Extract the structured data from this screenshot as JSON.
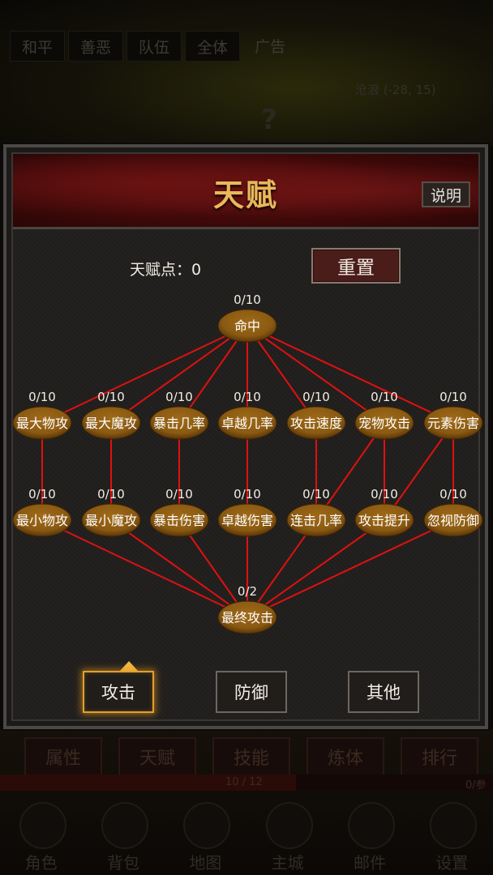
{
  "background": {
    "top_tabs": [
      "和平",
      "善恶",
      "队伍",
      "全体",
      "广告"
    ],
    "coords": "沧浪 (-28, 15)",
    "question_mark": "?",
    "menu_buttons": [
      "属性",
      "天赋",
      "技能",
      "炼体",
      "排行"
    ],
    "progress_text": "10 / 12",
    "progress_fraction": 0.6,
    "progress_right": "0/参",
    "nav": [
      {
        "label": "角色",
        "icon": "character-icon"
      },
      {
        "label": "背包",
        "icon": "bag-icon"
      },
      {
        "label": "地图",
        "icon": "map-icon"
      },
      {
        "label": "主城",
        "icon": "castle-icon"
      },
      {
        "label": "邮件",
        "icon": "mail-icon"
      },
      {
        "label": "设置",
        "icon": "settings-icon"
      }
    ]
  },
  "dialog": {
    "title": "天赋",
    "help_label": "说明",
    "points_label": "天赋点：0",
    "reset_label": "重置",
    "colors": {
      "node_fill": "#8a5a12",
      "link_color": "#e01010",
      "title_color": "#e9b85a",
      "active_border": "#e0a030"
    },
    "tree": {
      "root": {
        "label": "命中",
        "count": "0/10"
      },
      "row1": [
        {
          "label": "最大物攻",
          "count": "0/10"
        },
        {
          "label": "最大魔攻",
          "count": "0/10"
        },
        {
          "label": "暴击几率",
          "count": "0/10"
        },
        {
          "label": "卓越几率",
          "count": "0/10"
        },
        {
          "label": "攻击速度",
          "count": "0/10"
        },
        {
          "label": "宠物攻击",
          "count": "0/10"
        },
        {
          "label": "元素伤害",
          "count": "0/10"
        }
      ],
      "row2": [
        {
          "label": "最小物攻",
          "count": "0/10"
        },
        {
          "label": "最小魔攻",
          "count": "0/10"
        },
        {
          "label": "暴击伤害",
          "count": "0/10"
        },
        {
          "label": "卓越伤害",
          "count": "0/10"
        },
        {
          "label": "连击几率",
          "count": "0/10"
        },
        {
          "label": "攻击提升",
          "count": "0/10"
        },
        {
          "label": "忽视防御",
          "count": "0/10"
        }
      ],
      "final": {
        "label": "最终攻击",
        "count": "0/2"
      }
    },
    "categories": [
      {
        "label": "攻击",
        "active": true
      },
      {
        "label": "防御",
        "active": false
      },
      {
        "label": "其他",
        "active": false
      }
    ]
  }
}
